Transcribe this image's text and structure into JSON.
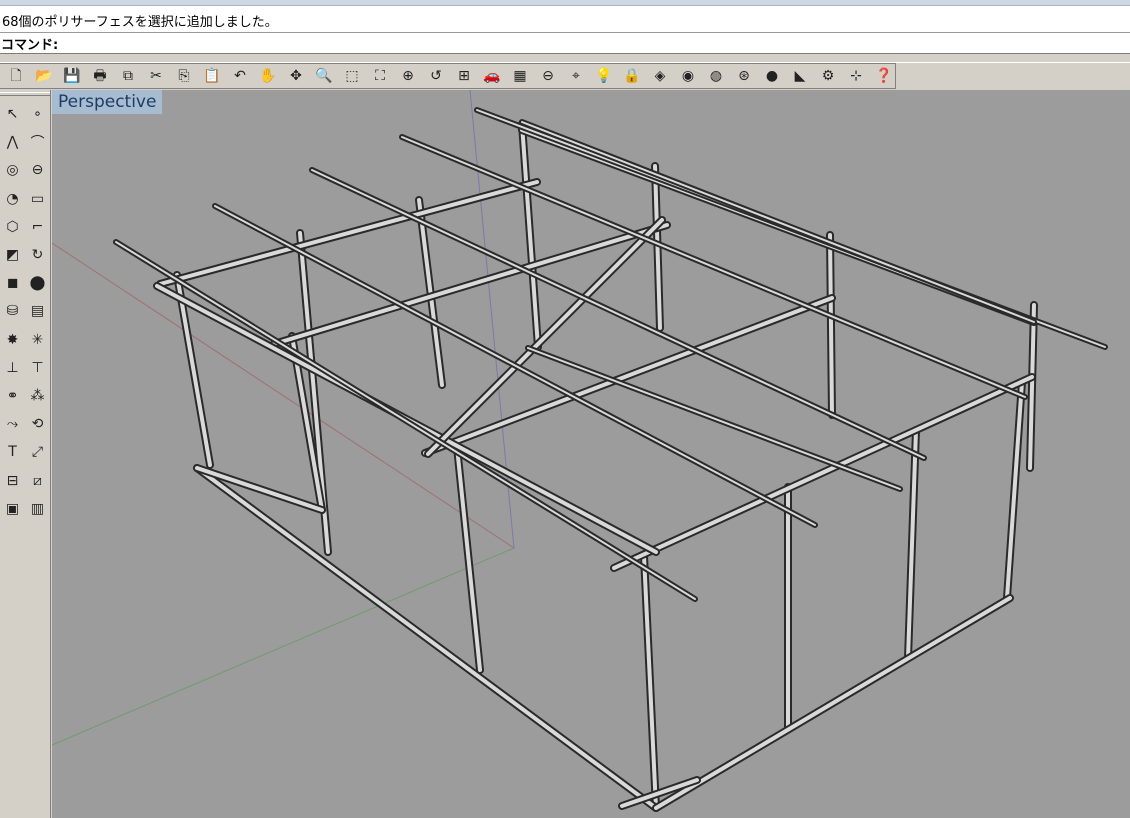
{
  "history": {
    "message": "68個のポリサーフェスを選択に追加しました。"
  },
  "command": {
    "label": "コマンド:",
    "value": ""
  },
  "toolbar": {
    "items": [
      {
        "name": "new-file-icon",
        "glyph": "🗋"
      },
      {
        "name": "open-file-icon",
        "glyph": "📂"
      },
      {
        "name": "save-icon",
        "glyph": "💾"
      },
      {
        "name": "print-icon",
        "glyph": "🖶"
      },
      {
        "name": "export-icon",
        "glyph": "⧉"
      },
      {
        "name": "cut-icon",
        "glyph": "✂"
      },
      {
        "name": "copy-icon",
        "glyph": "⎘"
      },
      {
        "name": "paste-icon",
        "glyph": "📋"
      },
      {
        "name": "undo-icon",
        "glyph": "↶"
      },
      {
        "name": "pan-hand-icon",
        "glyph": "✋"
      },
      {
        "name": "rotate-view-icon",
        "glyph": "✥"
      },
      {
        "name": "zoom-dynamic-icon",
        "glyph": "🔍"
      },
      {
        "name": "zoom-window-icon",
        "glyph": "⬚"
      },
      {
        "name": "zoom-extents-icon",
        "glyph": "⛶"
      },
      {
        "name": "zoom-selected-icon",
        "glyph": "⊕"
      },
      {
        "name": "undo-view-icon",
        "glyph": "↺"
      },
      {
        "name": "four-viewports-icon",
        "glyph": "⊞"
      },
      {
        "name": "set-view-icon",
        "glyph": "🚗"
      },
      {
        "name": "set-cplane-icon",
        "glyph": "▦"
      },
      {
        "name": "grid-snap-icon",
        "glyph": "⊖"
      },
      {
        "name": "osnap-icon",
        "glyph": "⌖"
      },
      {
        "name": "lights-icon",
        "glyph": "💡"
      },
      {
        "name": "lock-icon",
        "glyph": "🔒"
      },
      {
        "name": "layers-icon",
        "glyph": "◈"
      },
      {
        "name": "color-wheel-icon",
        "glyph": "◉"
      },
      {
        "name": "wireframe-icon",
        "glyph": "◍"
      },
      {
        "name": "ghosted-icon",
        "glyph": "⊛"
      },
      {
        "name": "render-sphere-icon",
        "glyph": "●"
      },
      {
        "name": "select-filter-icon",
        "glyph": "◣"
      },
      {
        "name": "settings-gear-icon",
        "glyph": "⚙"
      },
      {
        "name": "tools-icon",
        "glyph": "⊹"
      },
      {
        "name": "help-icon",
        "glyph": "❓"
      }
    ]
  },
  "left_toolbar": {
    "items": [
      {
        "name": "select-arrow-icon",
        "glyph": "↖"
      },
      {
        "name": "point-icon",
        "glyph": "∘"
      },
      {
        "name": "polyline-icon",
        "glyph": "⋀"
      },
      {
        "name": "curve-icon",
        "glyph": "⌒"
      },
      {
        "name": "circle-icon",
        "glyph": "◎"
      },
      {
        "name": "ellipse-icon",
        "glyph": "⊖"
      },
      {
        "name": "arc-icon",
        "glyph": "◔"
      },
      {
        "name": "rectangle-icon",
        "glyph": "▭"
      },
      {
        "name": "polygon-icon",
        "glyph": "⬡"
      },
      {
        "name": "fillet-curve-icon",
        "glyph": "⌐"
      },
      {
        "name": "surface-points-icon",
        "glyph": "◩"
      },
      {
        "name": "revolve-icon",
        "glyph": "↻"
      },
      {
        "name": "box-solid-icon",
        "glyph": "◼"
      },
      {
        "name": "boolean-union-icon",
        "glyph": "⬤"
      },
      {
        "name": "cylinder-icon",
        "glyph": "⛁"
      },
      {
        "name": "mesh-icon",
        "glyph": "▤"
      },
      {
        "name": "transform-icon",
        "glyph": "✸"
      },
      {
        "name": "explode-icon",
        "glyph": "✳"
      },
      {
        "name": "trim-icon",
        "glyph": "⊥"
      },
      {
        "name": "split-icon",
        "glyph": "⊤"
      },
      {
        "name": "group-icon",
        "glyph": "⚭"
      },
      {
        "name": "array-icon",
        "glyph": "⁂"
      },
      {
        "name": "move-icon",
        "glyph": "⤳"
      },
      {
        "name": "rotate-icon",
        "glyph": "⟲"
      },
      {
        "name": "text-icon",
        "glyph": "T"
      },
      {
        "name": "dimension-icon",
        "glyph": "⤢"
      },
      {
        "name": "block-icon",
        "glyph": "⊟"
      },
      {
        "name": "analyze-icon",
        "glyph": "⧄"
      },
      {
        "name": "render-box-icon",
        "glyph": "▣"
      },
      {
        "name": "hatch-icon",
        "glyph": "▥"
      }
    ]
  },
  "viewport": {
    "title": "Perspective"
  }
}
